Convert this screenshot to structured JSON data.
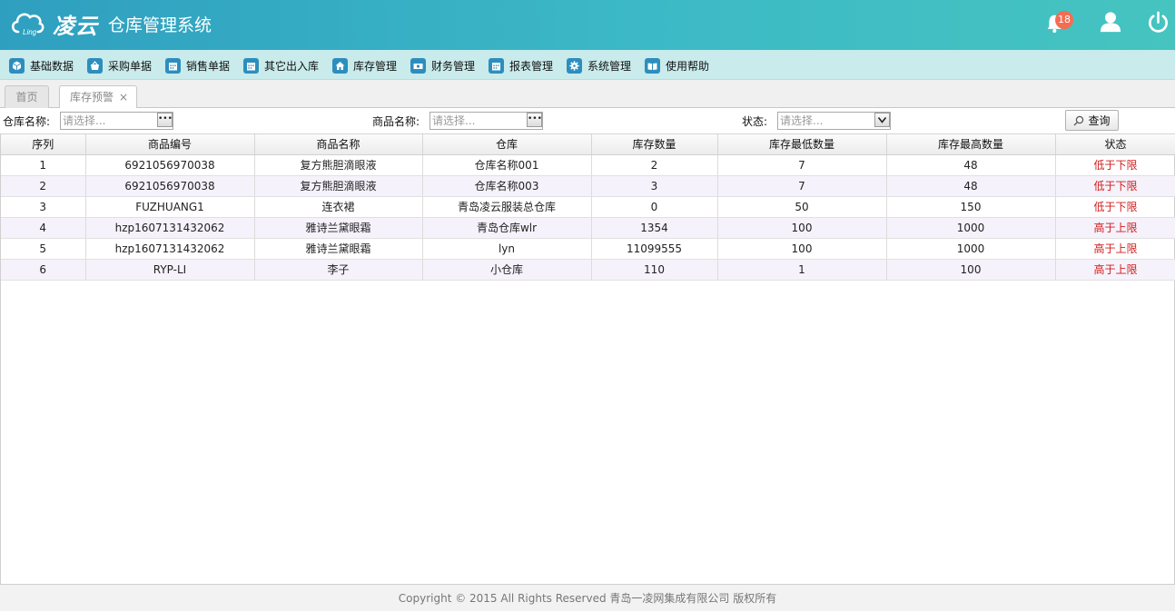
{
  "header": {
    "logo_text": "凌云",
    "logo_sub": "Ling",
    "system_title": "仓库管理系统",
    "notification_count": "18"
  },
  "menu": [
    {
      "label": "基础数据",
      "icon": "cube-icon"
    },
    {
      "label": "采购单据",
      "icon": "basket-icon"
    },
    {
      "label": "销售单据",
      "icon": "calendar-icon"
    },
    {
      "label": "其它出入库",
      "icon": "calendar-icon"
    },
    {
      "label": "库存管理",
      "icon": "home-icon"
    },
    {
      "label": "财务管理",
      "icon": "money-icon"
    },
    {
      "label": "报表管理",
      "icon": "calendar-icon"
    },
    {
      "label": "系统管理",
      "icon": "gear-icon"
    },
    {
      "label": "使用帮助",
      "icon": "book-icon"
    }
  ],
  "tabs": {
    "home": "首页",
    "active": "库存预警",
    "close": "×"
  },
  "search": {
    "warehouse_label": "仓库名称:",
    "warehouse_placeholder": "请选择...",
    "product_label": "商品名称:",
    "product_placeholder": "请选择...",
    "status_label": "状态:",
    "status_placeholder": "请选择...",
    "query_label": "查询"
  },
  "table": {
    "columns": [
      "序列",
      "商品编号",
      "商品名称",
      "仓库",
      "库存数量",
      "库存最低数量",
      "库存最高数量",
      "状态"
    ],
    "rows": [
      [
        "1",
        "6921056970038",
        "复方熊胆滴眼液",
        "仓库名称001",
        "2",
        "7",
        "48",
        "低于下限"
      ],
      [
        "2",
        "6921056970038",
        "复方熊胆滴眼液",
        "仓库名称003",
        "3",
        "7",
        "48",
        "低于下限"
      ],
      [
        "3",
        "FUZHUANG1",
        "连衣裙",
        "青岛凌云服装总仓库",
        "0",
        "50",
        "150",
        "低于下限"
      ],
      [
        "4",
        "hzp1607131432062",
        "雅诗兰黛眼霜",
        "青岛仓库wlr",
        "1354",
        "100",
        "1000",
        "高于上限"
      ],
      [
        "5",
        "hzp1607131432062",
        "雅诗兰黛眼霜",
        "lyn",
        "11099555",
        "100",
        "1000",
        "高于上限"
      ],
      [
        "6",
        "RYP-LI",
        "李子",
        "小仓库",
        "110",
        "1",
        "100",
        "高于上限"
      ]
    ]
  },
  "footer": {
    "text": "Copyright © 2015 All Rights Reserved 青岛一凌网集成有限公司 版权所有"
  },
  "colors": {
    "header_start": "#2f9fc0",
    "header_end": "#45c4c0",
    "menubar": "#c9ebec",
    "status_red": "#d11b1b",
    "badge": "#f36d52"
  }
}
